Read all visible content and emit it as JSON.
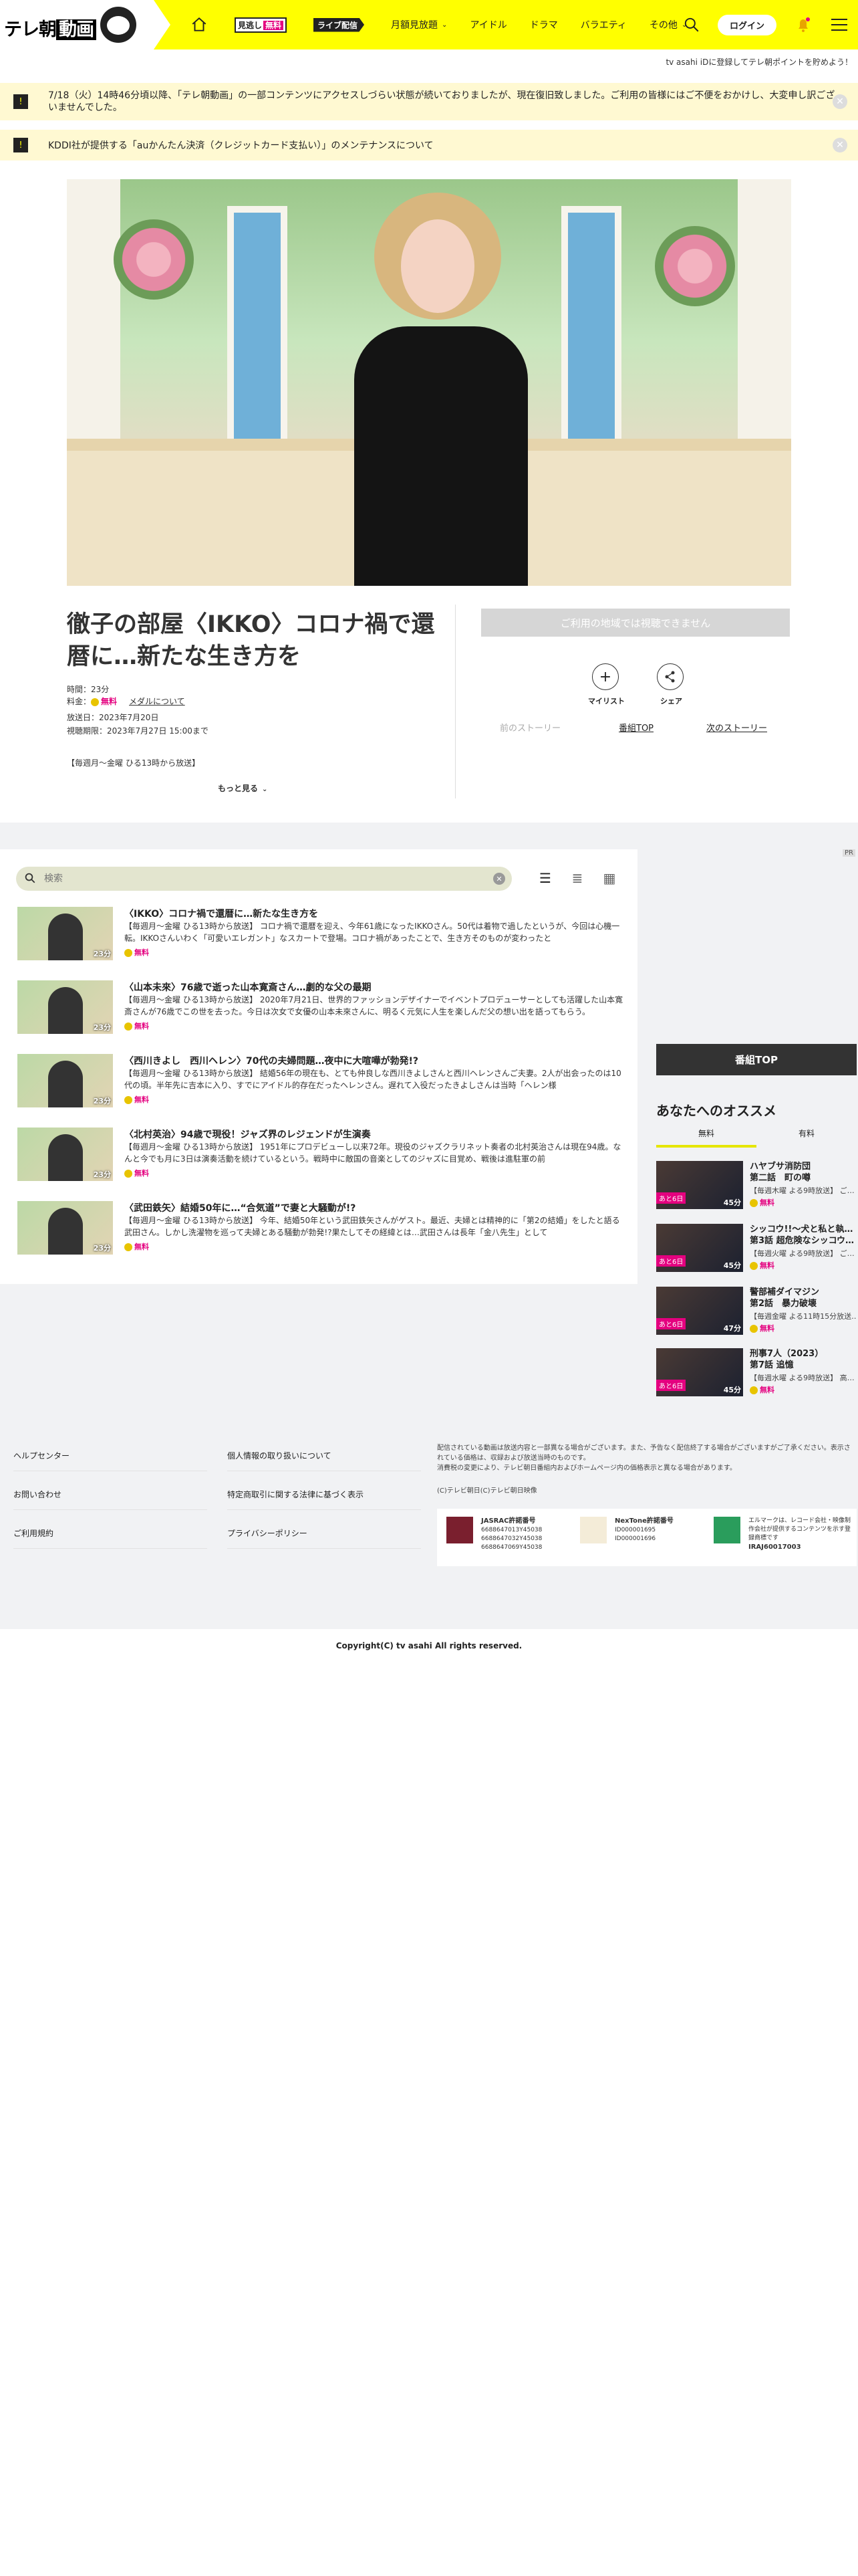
{
  "header": {
    "logo_text": "テレ朝",
    "logo_text2": "動画",
    "nav": {
      "free_badge_a": "見逃し",
      "free_badge_b": "無料",
      "live_badge": "ライブ配信",
      "monthly": "月額見放題",
      "idol": "アイドル",
      "drama": "ドラマ",
      "variety": "バラエティ",
      "other": "その他"
    },
    "login": "ログイン"
  },
  "topline": "tv asahi iDに登録してテレ朝ポイントを貯めよう！",
  "notices": [
    {
      "icon": "!",
      "text": "7/18（火）14時46分頃以降、「テレ朝動画」の一部コンテンツにアクセスしづらい状態が続いておりましたが、現在復旧致しました。ご利用の皆様にはご不便をおかけし、大変申し訳ございませんでした。"
    },
    {
      "icon": "!",
      "text": "KDDI社が提供する「auかんたん決済（クレジットカード支払い）」のメンテナンスについて"
    }
  ],
  "episode": {
    "title": "徹子の部屋〈IKKO〉コロナ禍で還暦に…新たな生き方を",
    "duration": "時間：23分",
    "price_label": "料金：",
    "price_free": "無料",
    "medal_link": "メダルについて",
    "aired": "放送日：2023年7月20日",
    "period": "視聴期限：2023年7月27日 15:00まで",
    "broadcast": "【毎週月〜金曜 ひる13時から放送】",
    "more": "もっと見る"
  },
  "actions": {
    "unavailable": "ご利用の地域では視聴できません",
    "mylist": "マイリスト",
    "share": "シェア",
    "prev": "前のストーリー",
    "top": "番組TOP",
    "next": "次のストーリー"
  },
  "search": {
    "placeholder": "検索"
  },
  "episodes": [
    {
      "title": "〈IKKO〉コロナ禍で還暦に…新たな生き方を",
      "desc": "【毎週月〜金曜 ひる13時から放送】 コロナ禍で還暦を迎え、今年61歳になったIKKOさん。50代は着物で過したというが、今回は心機一転。IKKOさんいわく「可愛いエレガント」なスカートで登場。コロナ禍があったことで、生き方そのものが変わったと",
      "dur": "23分",
      "free": "無料"
    },
    {
      "title": "〈山本未來〉76歳で逝った山本寛斎さん…劇的な父の最期",
      "desc": "【毎週月〜金曜 ひる13時から放送】 2020年7月21日、世界的ファッションデザイナーでイベントプロデューサーとしても活躍した山本寛斎さんが76歳でこの世を去った。今日は次女で女優の山本未來さんに、明るく元気に人生を楽しんだ父の想い出を語ってもらう。",
      "dur": "23分",
      "free": "無料"
    },
    {
      "title": "〈西川きよし　西川ヘレン〉70代の夫婦問題…夜中に大喧嘩が勃発!?",
      "desc": "【毎週月〜金曜 ひる13時から放送】 結婚56年の現在も、とても仲良しな西川きよしさんと西川ヘレンさんご夫妻。2人が出会ったのは10代の頃。半年先に吉本に入り、すでにアイドル的存在だったヘレンさん。遅れて入役だったきよしさんは当時「ヘレン様",
      "dur": "23分",
      "free": "無料"
    },
    {
      "title": "〈北村英治〉94歳で現役！ジャズ界のレジェンドが生演奏",
      "desc": "【毎週月〜金曜 ひる13時から放送】 1951年にプロデビューし以来72年。現役のジャズクラリネット奏者の北村英治さんは現在94歳。なんと今でも月に3日は演奏活動を続けているという。戦時中に敵国の音楽としてのジャズに目覚め、戦後は進駐軍の前",
      "dur": "23分",
      "free": "無料"
    },
    {
      "title": "〈武田鉄矢〉結婚50年に…“合気道”で妻と大騒動が!?",
      "desc": "【毎週月〜金曜 ひる13時から放送】 今年、結婚50年という武田鉄矢さんがゲスト。最近、夫婦とは精神的に「第2の結婚」をしたと語る武田さん。しかし洗濯物を巡って夫婦とある騒動が勃発!?果たしてその経緯とは…武田さんは長年「金八先生」として",
      "dur": "23分",
      "free": "無料"
    }
  ],
  "sidebar": {
    "pr": "PR",
    "top_button": "番組TOP",
    "rec_title": "あなたへのオススメ",
    "tab_free": "無料",
    "tab_paid": "有料",
    "recs": [
      {
        "title1": "ハヤブサ消防団",
        "title2": "第二話　町の噂",
        "sub": "【毎週木曜 よる9時放送】 ご…",
        "left": "あと6日",
        "dur": "45分",
        "free": "無料"
      },
      {
        "title1": "シッコウ!!〜犬と私と執…",
        "title2": "第3話 超危険なシッコウ…",
        "sub": "【毎週火曜 よる9時放送】 ご…",
        "left": "あと6日",
        "dur": "45分",
        "free": "無料"
      },
      {
        "title1": "警部補ダイマジン",
        "title2": "第2話　暴力破壊",
        "sub": "【毎週金曜 よる11時15分放送…",
        "left": "あと6日",
        "dur": "47分",
        "free": "無料"
      },
      {
        "title1": "刑事7人（2023）",
        "title2": "第7話 追憶",
        "sub": "【毎週水曜 よる9時放送】 高…",
        "left": "あと6日",
        "dur": "45分",
        "free": "無料"
      }
    ]
  },
  "footer": {
    "links_left": [
      "ヘルプセンター",
      "お問い合わせ",
      "ご利用規約"
    ],
    "links_right": [
      "個人情報の取り扱いについて",
      "特定商取引に関する法律に基づく表示",
      "プライバシーポリシー"
    ],
    "note1": "配信されている動画は放送内容と一部異なる場合がございます。また、予告なく配信終了する場合がございますがご了承ください。表示されている価格は、収録および放送当時のものです。",
    "note2": "消費税の変更により、テレビ朝日番組内およびホームページ内の価格表示と異なる場合があります。",
    "note3": "(C)テレビ朝日(C)テレビ朝日映像",
    "jasrac_title": "JASRAC許諾番号",
    "jasrac_nums": [
      "6688647013Y45038",
      "6688647032Y45038",
      "6688647069Y45038"
    ],
    "nextone_title": "NexTone許諾番号",
    "nextone_nums": [
      "ID000001695",
      "ID000001696"
    ],
    "elmark_text": "エルマークは、レコード会社・映像制作会社が提供するコンテンツを示す登録商標です",
    "elmark_num": "IRAJ60017003",
    "copyright": "Copyright(C) tv asahi All rights reserved."
  }
}
